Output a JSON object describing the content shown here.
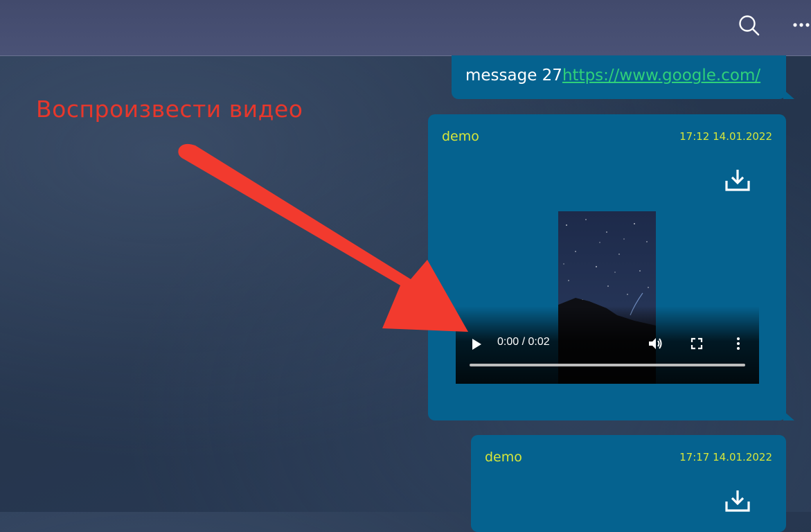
{
  "header": {
    "search_icon": "search-icon",
    "more_icon": "more-horizontal-icon"
  },
  "messages": [
    {
      "text": "message 27",
      "link": "https://www.google.com/"
    },
    {
      "author": "demo",
      "timestamp": "17:12 14.01.2022",
      "download_icon": "download-icon",
      "video": {
        "timecode": "0:00 / 0:02",
        "progress": 0
      }
    },
    {
      "author": "demo",
      "timestamp": "17:17 14.01.2022",
      "download_icon": "download-icon"
    }
  ],
  "annotation": {
    "label": "Воспроизвести видео",
    "color": "#e8372b"
  },
  "colors": {
    "bubble": "#05628f",
    "author": "#d6e63a",
    "link": "#2fd07a",
    "header": "#454d70"
  }
}
